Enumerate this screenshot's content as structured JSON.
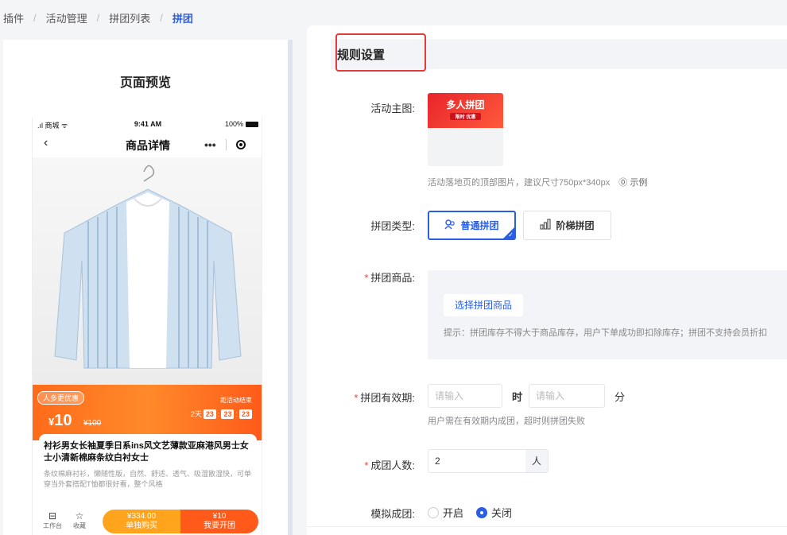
{
  "breadcrumb": {
    "items": [
      "插件",
      "活动管理",
      "拼团列表"
    ],
    "current": "拼团"
  },
  "preview": {
    "title": "页面预览",
    "statusbar": {
      "carrier": ".ıl 商城 ᯤ",
      "time": "9:41 AM",
      "battery": "100%"
    },
    "nav": {
      "back": "‹",
      "title": "商品详情",
      "more": "•••"
    },
    "promo": {
      "tag": "人多更优惠",
      "currency": "¥",
      "price": "10",
      "original": "¥100",
      "end_label": "距活动结束",
      "countdown": {
        "days": "2天",
        "h": "23",
        "m": "23",
        "s": "23"
      }
    },
    "product": {
      "title": "衬衫男女长袖夏季日系ins风文艺薄款亚麻港风男士女士小清新棉麻条纹白衬女士",
      "desc": "条纹棉麻衬衫，懒随性版，自然、舒适、透气、吸湿散湿快，可单穿当外套搭配T恤都很好看，整个风格"
    },
    "bottom": {
      "workbench": "工作台",
      "favorite": "收藏",
      "single_price": "¥334.00",
      "single_label": "单独购买",
      "group_price": "¥10",
      "group_label": "我要开团"
    }
  },
  "form": {
    "section_title": "规则设置",
    "main_image": {
      "label": "活动主图:",
      "banner_text": "多人拼团",
      "banner_sub": "限时 优惠",
      "hint": "活动落地页的顶部图片，建议尺寸750px*340px",
      "example": "⓪ 示例"
    },
    "group_type": {
      "label": "拼团类型:",
      "options": [
        {
          "label": "普通拼团",
          "active": true
        },
        {
          "label": "阶梯拼团",
          "active": false
        }
      ]
    },
    "goods": {
      "label": "拼团商品:",
      "button": "选择拼团商品",
      "hint": "提示：拼团库存不得大于商品库存，用户下单成功即扣除库存；拼团不支持会员折扣"
    },
    "validity": {
      "label": "拼团有效期:",
      "hour_placeholder": "请输入",
      "hour_unit": "时",
      "minute_placeholder": "请输入",
      "minute_unit": "分",
      "hint": "用户需在有效期内成团，超时则拼团失败"
    },
    "group_size": {
      "label": "成团人数:",
      "value": "2",
      "unit": "人"
    },
    "simulate": {
      "label": "模拟成团:",
      "options": [
        {
          "label": "开启",
          "checked": false
        },
        {
          "label": "关闭",
          "checked": true
        }
      ]
    }
  },
  "colors": {
    "accent": "#2b5ee6",
    "highlight": "#e23b3b",
    "required": "#f04040",
    "promo": "#ff5a1a"
  }
}
